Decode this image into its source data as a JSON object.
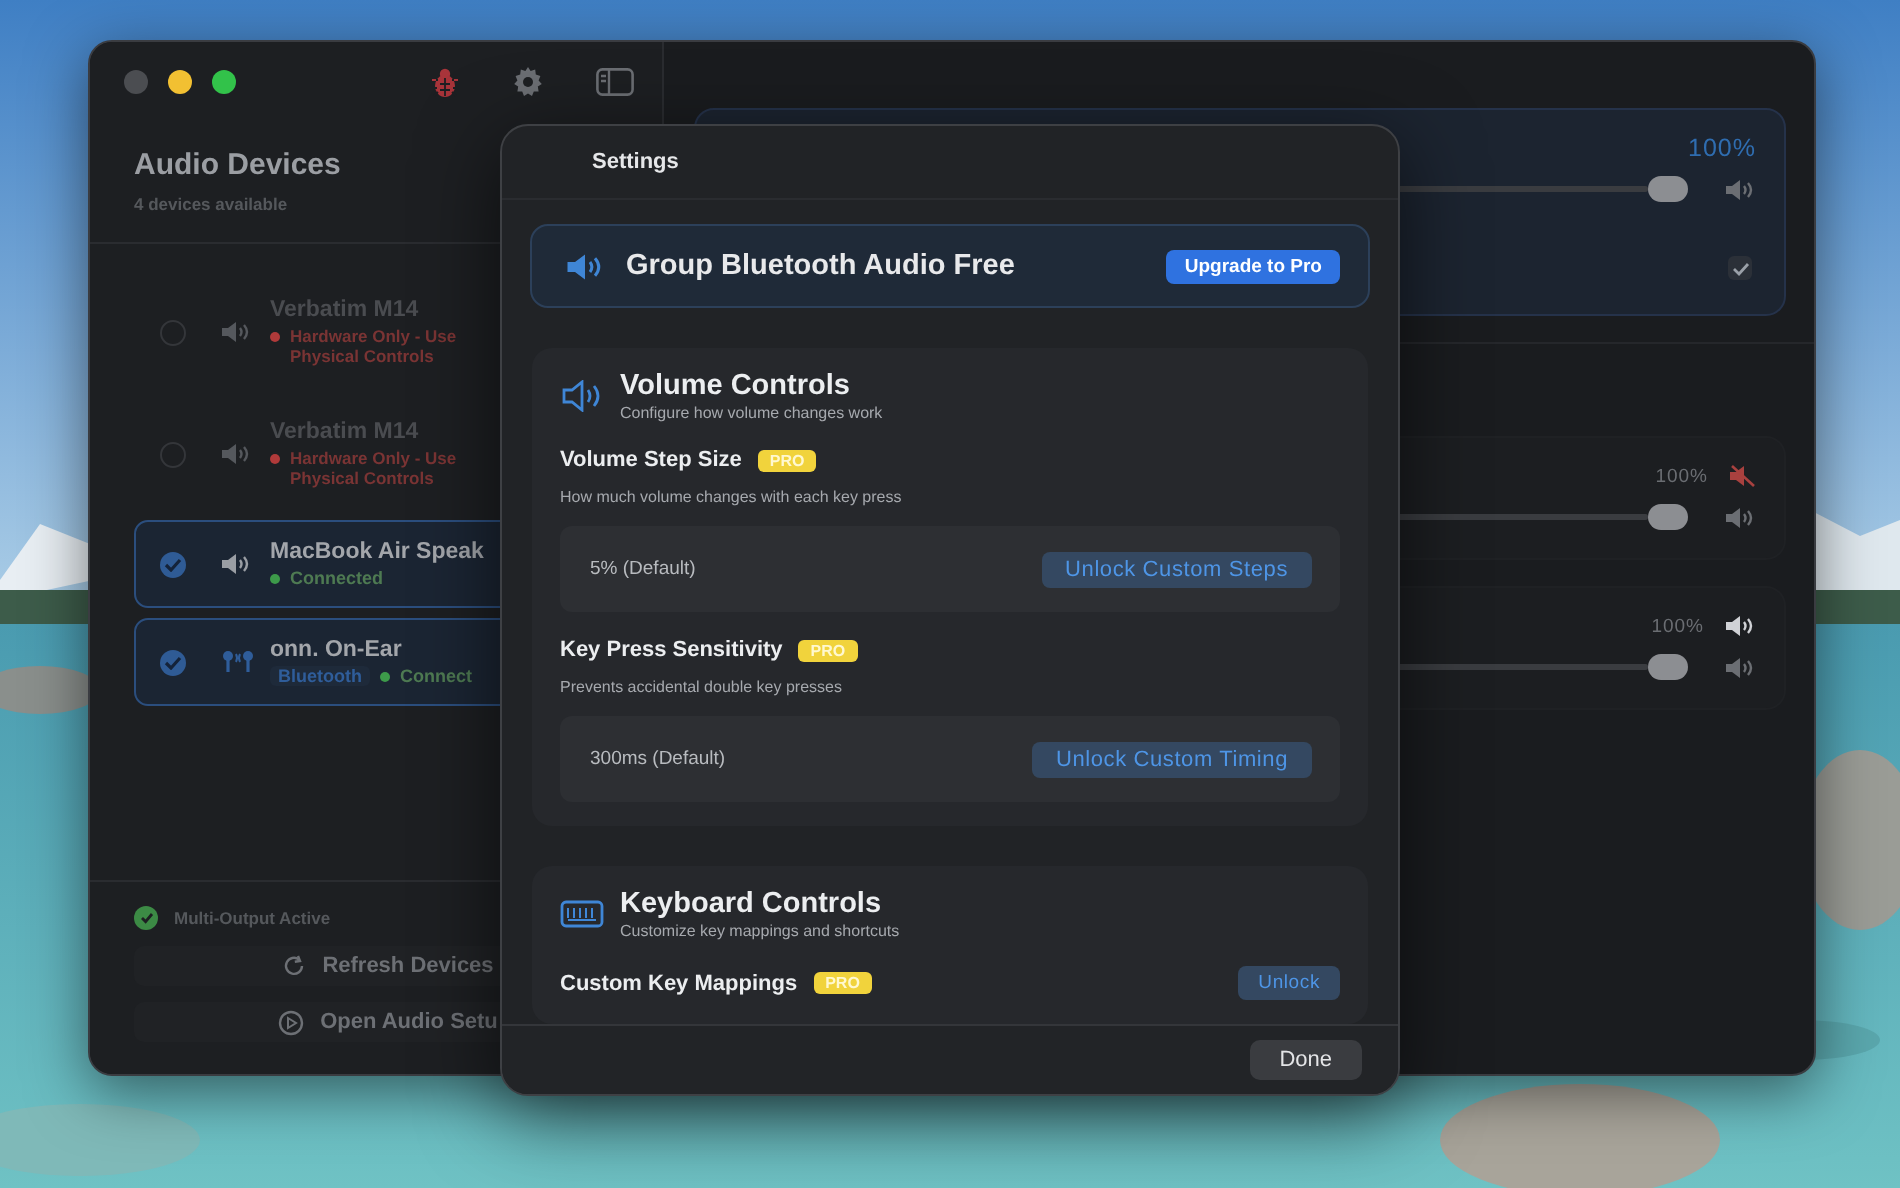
{
  "sidebar": {
    "title": "Audio Devices",
    "subtitle": "4 devices available",
    "devices": [
      {
        "name": "Verbatim M14",
        "kind": "speaker",
        "status": "Hardware Only - Use",
        "status_2": "Physical Controls",
        "color": "#b03a3a",
        "selected": false,
        "disabled": true
      },
      {
        "name": "Verbatim M14",
        "kind": "speaker",
        "status": "Hardware Only - Use",
        "status_2": "Physical Controls",
        "color": "#b03a3a",
        "selected": false,
        "disabled": true
      },
      {
        "name": "MacBook Air Speak",
        "kind": "speaker",
        "status": "Connected",
        "color": "#3d9a4a",
        "selected": true,
        "disabled": false
      },
      {
        "name": "onn. On-Ear",
        "kind": "earbuds",
        "tag": "Bluetooth",
        "status": "Connect",
        "color": "#3d9a4a",
        "selected": true,
        "disabled": false
      }
    ],
    "footer_status": "Multi-Output Active",
    "buttons": [
      {
        "label": "Refresh Devices",
        "kind": "refresh"
      },
      {
        "label": "Open Audio Setu",
        "kind": "open"
      }
    ]
  },
  "outputs": [
    {
      "reading": "100%",
      "level": 1,
      "selected": true,
      "checked": true
    },
    {
      "reading": "100%",
      "level": 1,
      "selected": false,
      "muted": true
    },
    {
      "reading": "100%",
      "level": 1,
      "selected": false,
      "muted": false
    }
  ],
  "settings": {
    "title": "Settings",
    "banner": {
      "title": "Group Bluetooth Audio Free",
      "button": "Upgrade to Pro"
    },
    "sections": [
      {
        "kind": "volume",
        "title": "Volume Controls",
        "subtitle": "Configure how volume changes work",
        "items": [
          {
            "label": "Volume Step Size",
            "badge": "PRO",
            "description": "How much volume changes with each key press",
            "value": "5% (Default)",
            "button": "Unlock Custom Steps"
          },
          {
            "label": "Key Press Sensitivity",
            "badge": "PRO",
            "description": "Prevents accidental double key presses",
            "value": "300ms (Default)",
            "button": "Unlock Custom Timing"
          }
        ]
      },
      {
        "kind": "keyboard",
        "title": "Keyboard Controls",
        "subtitle": "Customize key mappings and shortcuts",
        "items": [
          {
            "label": "Custom Key Mappings",
            "badge": "PRO",
            "button": "Unlock"
          }
        ]
      }
    ],
    "done": "Done"
  }
}
